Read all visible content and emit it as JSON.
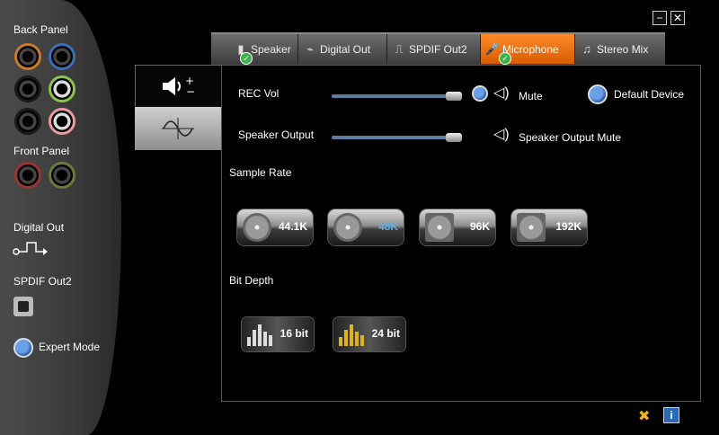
{
  "left_panel": {
    "back_panel_label": "Back Panel",
    "front_panel_label": "Front Panel",
    "digital_out_label": "Digital Out",
    "spdif_out2_label": "SPDIF Out2",
    "expert_mode_label": "Expert Mode"
  },
  "window_buttons": {
    "minimize": "−",
    "close": "✕"
  },
  "tabs": [
    {
      "label": "Speaker",
      "icon": "speaker-icon",
      "glyph": "▮"
    },
    {
      "label": "Digital Out",
      "icon": "plug-icon",
      "glyph": "⌁"
    },
    {
      "label": "SPDIF Out2",
      "icon": "square-wave-icon",
      "glyph": "⎍"
    },
    {
      "label": "Microphone",
      "icon": "microphone-icon",
      "glyph": "🎤"
    },
    {
      "label": "Stereo Mix",
      "icon": "music-note-icon",
      "glyph": "♫"
    }
  ],
  "active_tab": "Microphone",
  "accent_color": "#e8700f",
  "mixer": {
    "rec_vol_label": "REC Vol",
    "rec_vol_level": 0.97,
    "mute_label": "Mute",
    "default_device_label": "Default Device",
    "speaker_output_label": "Speaker Output",
    "speaker_output_level": 0.97,
    "speaker_output_mute_label": "Speaker Output Mute"
  },
  "sample_rate": {
    "label": "Sample Rate",
    "options": [
      "44.1K",
      "48K",
      "96K",
      "192K"
    ],
    "selected": "48K"
  },
  "bit_depth": {
    "label": "Bit Depth",
    "options": [
      "16 bit",
      "24 bit"
    ],
    "selected": "24 bit"
  }
}
